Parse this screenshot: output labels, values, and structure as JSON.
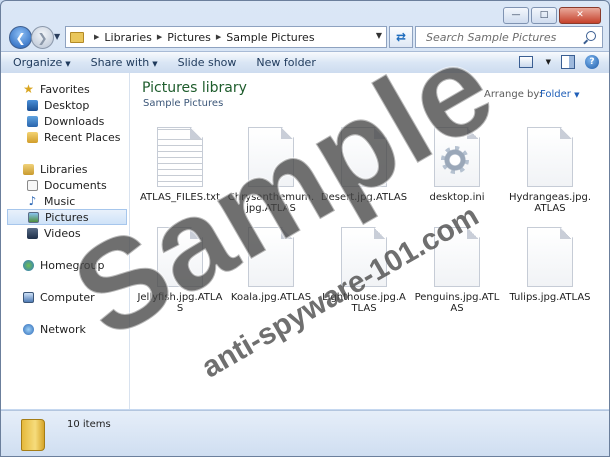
{
  "window": {
    "caption_icons": [
      "minimize-icon",
      "maximize-icon",
      "close-icon"
    ]
  },
  "navigation": {
    "back_icon": "arrow-left-icon",
    "forward_icon": "arrow-right-icon",
    "breadcrumb": [
      "Libraries",
      "Pictures",
      "Sample Pictures"
    ],
    "refresh_icon": "refresh-icon",
    "search_placeholder": "Search Sample Pictures"
  },
  "toolbar": {
    "organize": "Organize",
    "share_with": "Share with",
    "slide_show": "Slide show",
    "new_folder": "New folder"
  },
  "sidebar": {
    "favorites": "Favorites",
    "favorites_items": [
      "Desktop",
      "Downloads",
      "Recent Places"
    ],
    "libraries": "Libraries",
    "library_items": [
      "Documents",
      "Music",
      "Pictures",
      "Videos"
    ],
    "selected": "Pictures",
    "homegroup": "Homegroup",
    "computer": "Computer",
    "network": "Network"
  },
  "library": {
    "title": "Pictures library",
    "subtitle": "Sample Pictures",
    "arrange_label": "Arrange by:",
    "arrange_value": "Folder"
  },
  "files": [
    "ATLAS_FILES.txt",
    "Chrysanthemum.jpg.ATLAS",
    "Desert.jpg.ATLAS",
    "desktop.ini",
    "Hydrangeas.jpg.ATLAS",
    "Jellyfish.jpg.ATLAS",
    "Koala.jpg.ATLAS",
    "Lighthouse.jpg.ATLAS",
    "Penguins.jpg.ATLAS",
    "Tulips.jpg.ATLAS"
  ],
  "status": {
    "item_count": "10 items"
  },
  "watermark": {
    "large": "Sample",
    "small": "anti-spyware-101.com"
  },
  "colors": {
    "library_title": "#1e5c2c",
    "link_blue": "#1f5fb8",
    "selection": "#cfe3f8"
  }
}
